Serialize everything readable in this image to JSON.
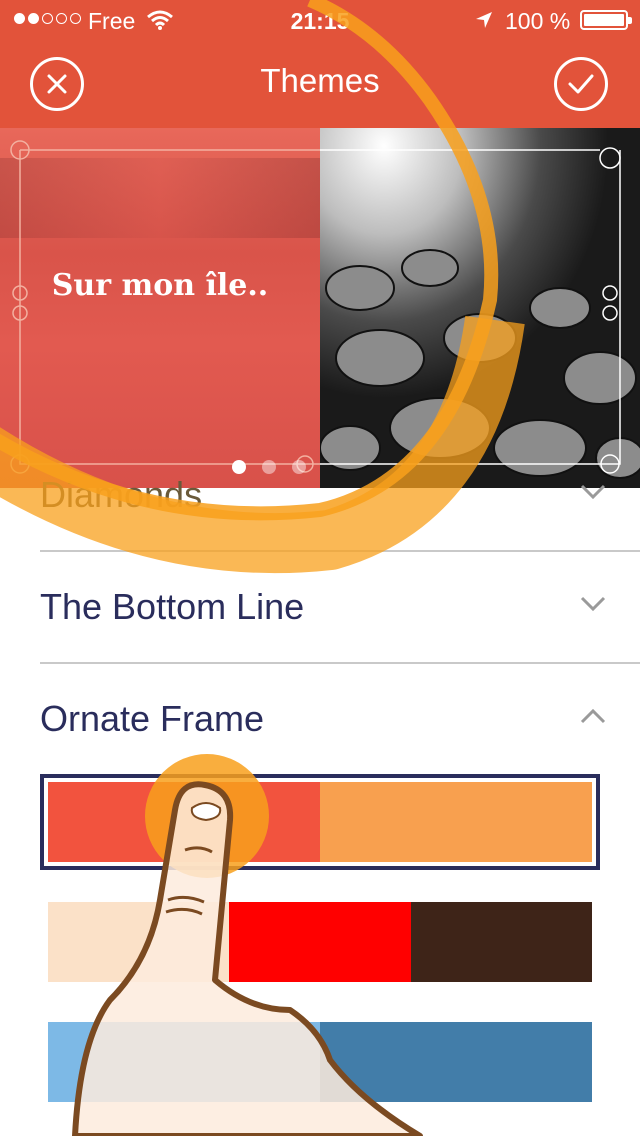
{
  "status_bar": {
    "carrier": "Free",
    "time": "21:15",
    "battery_percent": "100 %",
    "signal_bars": 2,
    "signal_total": 5
  },
  "nav": {
    "title": "Themes",
    "left_icon": "close-icon",
    "right_icon": "checkmark-icon"
  },
  "preview": {
    "caption": "Sur mon île..",
    "pages": 3,
    "current_page": 1
  },
  "themes": [
    {
      "label": "Diamonds",
      "expanded": false
    },
    {
      "label": "The Bottom Line",
      "expanded": false
    },
    {
      "label": "Ornate Frame",
      "expanded": true
    }
  ],
  "palettes": [
    {
      "selected": true,
      "colors": [
        "#F2533E",
        "#F8A04F"
      ]
    },
    {
      "selected": false,
      "colors": [
        "#FBE1C8",
        "#FF0000",
        "#3E2418"
      ]
    },
    {
      "selected": false,
      "colors": [
        "#7DB9E6",
        "#427DA9"
      ]
    }
  ],
  "colors": {
    "accent": "#E2533A",
    "text": "#2a2d5c",
    "highlight": "#F8A01C"
  }
}
